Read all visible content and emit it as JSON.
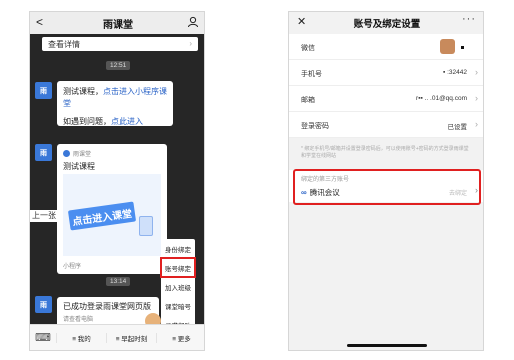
{
  "left": {
    "title": "雨课堂",
    "back_glyph": "<",
    "detail_bar": "查看详情",
    "time1": "12:51",
    "time2": "13:14",
    "bubble1": {
      "line1a": "测试课程，",
      "line1b": "点击进入小程序课堂",
      "line2a": "如遇到问题，",
      "line2b": "点此进入"
    },
    "card": {
      "source": "雨课堂",
      "title": "测试课程",
      "banner_text": "点击进入课堂",
      "footer": "小程序"
    },
    "side_text": "上一张",
    "menu": [
      "身份绑定",
      "账号绑定",
      "加入班级",
      "课堂暗号",
      "寻求帮助"
    ],
    "bubble2": {
      "title": "已成功登录雨课堂网页版",
      "subtitle": "请查看电脑"
    },
    "tabs": [
      "我的",
      "早起时刻",
      "更多"
    ],
    "tab_prefix": "≡"
  },
  "right": {
    "title": "账号及绑定设置",
    "rows": [
      {
        "label": "微信",
        "value": ""
      },
      {
        "label": "手机号",
        "value": "▪ :32442"
      },
      {
        "label": "邮箱",
        "value": "r▪▪ .. .01@qq.com"
      },
      {
        "label": "登录密码",
        "value": "已设置"
      }
    ],
    "note": "* 绑定手机号/邮箱并设置登录密码后，可以使用账号+密码的方式登录雨课堂和学堂在线网站",
    "third_party": {
      "header": "绑定的第三方账号",
      "name": "腾讯会议",
      "state": "去绑定"
    }
  },
  "colors": {
    "accent_blue": "#3a78d8",
    "highlight_red": "#e02020"
  }
}
